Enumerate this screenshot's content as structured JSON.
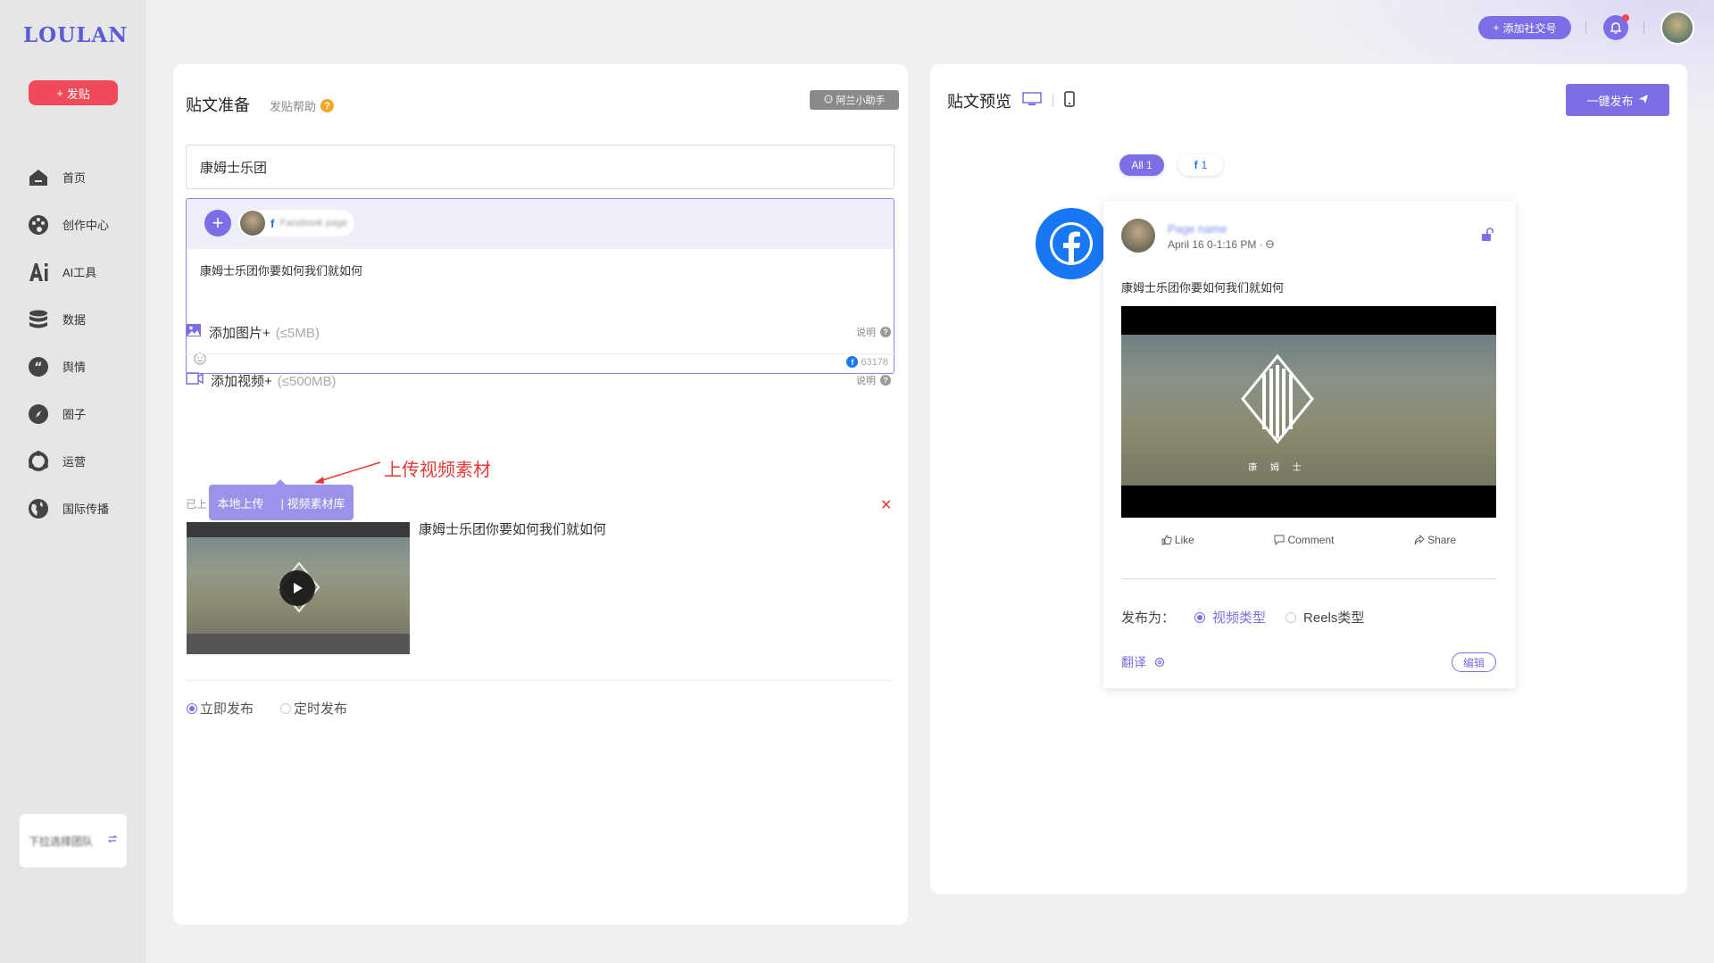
{
  "brand": {
    "logo": "LOULAN",
    "accent": "#7b6ee6",
    "danger": "#f04a5a",
    "facebook": "#1877f2"
  },
  "sidebar": {
    "post_button": "发贴",
    "items": [
      {
        "label": "首页",
        "icon": "home-icon"
      },
      {
        "label": "创作中心",
        "icon": "palette-icon"
      },
      {
        "label": "AI工具",
        "icon": "ai-icon"
      },
      {
        "label": "数据",
        "icon": "database-icon"
      },
      {
        "label": "舆情",
        "icon": "quote-icon"
      },
      {
        "label": "圈子",
        "icon": "compass-icon"
      },
      {
        "label": "运营",
        "icon": "operations-icon"
      },
      {
        "label": "国际传播",
        "icon": "globe-icon"
      }
    ],
    "switch_card": {
      "text": "下拉选择团队"
    }
  },
  "topbar": {
    "add_social": "添加社交号"
  },
  "compose": {
    "title": "贴文准备",
    "help": "发贴帮助",
    "assistant": "阿兰小助手",
    "title_value": "康姆士乐团",
    "account_platform": "f",
    "account_name": "Facebook page",
    "body_text": "康姆士乐团你要如何我们就如何",
    "char_count": "63178",
    "add_image": {
      "label": "添加图片+",
      "limit": "(≤5MB)",
      "explain": "说明"
    },
    "add_video": {
      "label": "添加视频+",
      "limit": "(≤500MB)",
      "explain": "说明"
    },
    "annotation": "上传视频素材",
    "tooltip": {
      "local": "本地上传",
      "library": "| 视频素材库"
    },
    "uploaded_label": "已上",
    "video_caption": "康姆士乐团你要如何我们就如何",
    "publish_options": {
      "now": "立即发布",
      "scheduled": "定时发布",
      "selected": "now"
    }
  },
  "preview": {
    "title": "贴文预览",
    "publish_button": "一键发布",
    "filter_all": "All 1",
    "filter_fb": "1",
    "page_name": "Page name",
    "time": "April 16 0-1:16 PM ·",
    "text": "康姆士乐团你要如何我们就如何",
    "video_logo_text": "康 姆 士",
    "actions": {
      "like": "Like",
      "comment": "Comment",
      "share": "Share"
    },
    "publish_as_label": "发布为：",
    "type_video": "视频类型",
    "type_reels": "Reels类型",
    "selected_type": "video",
    "translate": "翻译",
    "edit": "编辑"
  }
}
